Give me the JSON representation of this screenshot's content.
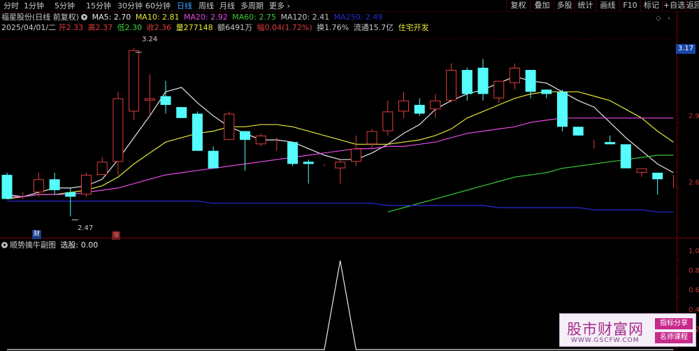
{
  "toolbar": {
    "periods": [
      "分时",
      "1分钟",
      "5分钟",
      "15分钟",
      "30分钟",
      "60分钟",
      "日线",
      "周线",
      "月线",
      "多周期",
      "更多"
    ],
    "active_period": "日线",
    "right_buttons": [
      "复权",
      "叠加",
      "多股",
      "统计",
      "画线",
      "F10",
      "标记",
      "+自选",
      "返回"
    ]
  },
  "stock": {
    "name": "福星股份(日线 前复权)",
    "date": "2025/04/01/二",
    "open_label": "开",
    "open": "2.33",
    "high_label": "高",
    "high": "2.37",
    "low_label": "低",
    "low": "2.30",
    "close_label": "收",
    "close": "2.36",
    "volume_label": "量",
    "volume": "277148",
    "amount_label": "额",
    "amount": "6491万",
    "change_label": "幅",
    "change": "0.04(1.72%)",
    "turnover": "换1.76%",
    "float_cap": "流通15.7亿",
    "sector": "住宅开发"
  },
  "ma": {
    "ma5": "MA5: 2.70",
    "ma10": "MA10: 2.81",
    "ma20": "MA20: 2.92",
    "ma60": "MA60: 2.75",
    "ma120": "MA120: 2.41",
    "ma250": "MA250: 2.49"
  },
  "colors": {
    "up": "#e03c3c",
    "down": "#54fcfc",
    "ma5": "#e8e8e8",
    "ma10": "#e6e63a",
    "ma20": "#e64ce6",
    "ma60": "#38c838",
    "ma250": "#2a2ad8",
    "accent": "#3c9dff"
  },
  "price_axis": {
    "current_price": "3.17",
    "ticks": [
      "2.9",
      "2.6"
    ],
    "high_marker": "3.24",
    "low_marker": "2.47"
  },
  "markers": {
    "finance": "财",
    "limit_up": "涨"
  },
  "sub_panel": {
    "title": "顺势擒牛副图",
    "value": "选股: 0.00",
    "ticks": [
      "1.0",
      "0.8",
      "0.6",
      "0.4",
      "0.2"
    ]
  },
  "watermark": {
    "title": "股市财富网",
    "url": "WWW.GSCFW.COM",
    "tag1": "指标分享",
    "tag2": "名师课程"
  },
  "chart_data": {
    "type": "candlestick",
    "x": [
      1,
      2,
      3,
      4,
      5,
      6,
      7,
      8,
      9,
      10,
      11,
      12,
      13,
      14,
      15,
      16,
      17,
      18,
      19,
      20,
      21,
      22,
      23,
      24,
      25,
      26,
      27,
      28,
      29,
      30,
      31,
      32,
      33,
      34,
      35,
      36,
      37,
      38,
      39,
      40,
      41,
      42,
      43
    ],
    "candles": [
      {
        "o": 2.66,
        "h": 2.67,
        "c": 2.55,
        "l": 2.55
      },
      {
        "o": 2.56,
        "h": 2.58,
        "c": 2.56,
        "l": 2.55
      },
      {
        "o": 2.58,
        "h": 2.67,
        "c": 2.64,
        "l": 2.56
      },
      {
        "o": 2.64,
        "h": 2.67,
        "c": 2.59,
        "l": 2.57
      },
      {
        "o": 2.58,
        "h": 2.6,
        "c": 2.56,
        "l": 2.47
      },
      {
        "o": 2.57,
        "h": 2.67,
        "c": 2.66,
        "l": 2.56
      },
      {
        "o": 2.66,
        "h": 2.74,
        "c": 2.72,
        "l": 2.66
      },
      {
        "o": 2.72,
        "h": 3.04,
        "c": 3.01,
        "l": 2.66
      },
      {
        "o": 2.95,
        "h": 3.24,
        "c": 3.23,
        "l": 2.91
      },
      {
        "o": 3.0,
        "h": 3.12,
        "c": 3.01,
        "l": 2.93
      },
      {
        "o": 3.02,
        "h": 3.09,
        "c": 2.98,
        "l": 2.94
      },
      {
        "o": 2.97,
        "h": 2.97,
        "c": 2.92,
        "l": 2.92
      },
      {
        "o": 2.94,
        "h": 2.95,
        "c": 2.77,
        "l": 2.77
      },
      {
        "o": 2.77,
        "h": 2.79,
        "c": 2.69,
        "l": 2.69
      },
      {
        "o": 2.82,
        "h": 2.95,
        "c": 2.94,
        "l": 2.82
      },
      {
        "o": 2.86,
        "h": 2.86,
        "c": 2.82,
        "l": 2.68
      },
      {
        "o": 2.8,
        "h": 2.85,
        "c": 2.84,
        "l": 2.79
      },
      {
        "o": 2.82,
        "h": 2.83,
        "c": 2.82,
        "l": 2.77
      },
      {
        "o": 2.81,
        "h": 2.81,
        "c": 2.71,
        "l": 2.7
      },
      {
        "o": 2.72,
        "h": 2.73,
        "c": 2.71,
        "l": 2.62
      },
      {
        "o": 2.7,
        "h": 2.71,
        "c": 2.7,
        "l": 2.7
      },
      {
        "o": 2.69,
        "h": 2.73,
        "c": 2.72,
        "l": 2.62
      },
      {
        "o": 2.72,
        "h": 2.84,
        "c": 2.78,
        "l": 2.7
      },
      {
        "o": 2.8,
        "h": 2.87,
        "c": 2.86,
        "l": 2.78
      },
      {
        "o": 2.86,
        "h": 3.0,
        "c": 2.95,
        "l": 2.84
      },
      {
        "o": 2.95,
        "h": 3.04,
        "c": 3.0,
        "l": 2.92
      },
      {
        "o": 2.98,
        "h": 3.01,
        "c": 2.94,
        "l": 2.93
      },
      {
        "o": 2.96,
        "h": 3.03,
        "c": 3.0,
        "l": 2.92
      },
      {
        "o": 3.0,
        "h": 3.17,
        "c": 3.14,
        "l": 2.99
      },
      {
        "o": 3.14,
        "h": 3.15,
        "c": 3.03,
        "l": 3.0
      },
      {
        "o": 3.15,
        "h": 3.19,
        "c": 3.03,
        "l": 3.0
      },
      {
        "o": 3.01,
        "h": 3.09,
        "c": 3.09,
        "l": 2.99
      },
      {
        "o": 3.08,
        "h": 3.17,
        "c": 3.15,
        "l": 3.05
      },
      {
        "o": 3.14,
        "h": 3.14,
        "c": 3.04,
        "l": 3.01
      },
      {
        "o": 3.05,
        "h": 3.05,
        "c": 3.03,
        "l": 3.01
      },
      {
        "o": 3.04,
        "h": 3.05,
        "c": 2.88,
        "l": 2.86
      },
      {
        "o": 2.88,
        "h": 2.88,
        "c": 2.84,
        "l": 2.84
      },
      {
        "o": 2.82,
        "h": 2.82,
        "c": 2.82,
        "l": 2.78
      },
      {
        "o": 2.81,
        "h": 2.84,
        "c": 2.8,
        "l": 2.8
      },
      {
        "o": 2.8,
        "h": 2.8,
        "c": 2.69,
        "l": 2.69
      },
      {
        "o": 2.67,
        "h": 2.69,
        "c": 2.69,
        "l": 2.65
      },
      {
        "o": 2.67,
        "h": 2.67,
        "c": 2.64,
        "l": 2.57
      },
      {
        "o": 2.62,
        "h": 2.66,
        "c": 2.62,
        "l": 2.6
      }
    ],
    "series": [
      {
        "name": "MA5",
        "values": [
          2.57,
          2.56,
          2.58,
          2.6,
          2.6,
          2.61,
          2.64,
          2.73,
          2.83,
          2.93,
          3.04,
          3.06,
          2.99,
          2.93,
          2.88,
          2.85,
          2.82,
          2.82,
          2.81,
          2.78,
          2.75,
          2.73,
          2.73,
          2.76,
          2.8,
          2.85,
          2.89,
          2.96,
          3.0,
          3.03,
          3.05,
          3.08,
          3.11,
          3.09,
          3.08,
          3.04,
          3.0,
          2.97,
          2.9,
          2.83,
          2.77,
          2.71,
          2.67
        ]
      },
      {
        "name": "MA10",
        "values": [
          2.55,
          2.56,
          2.57,
          2.57,
          2.58,
          2.59,
          2.61,
          2.65,
          2.71,
          2.76,
          2.81,
          2.83,
          2.85,
          2.86,
          2.88,
          2.88,
          2.89,
          2.89,
          2.88,
          2.86,
          2.84,
          2.82,
          2.8,
          2.8,
          2.8,
          2.81,
          2.82,
          2.84,
          2.87,
          2.92,
          2.95,
          2.98,
          3.01,
          3.03,
          3.04,
          3.04,
          3.04,
          3.02,
          3.0,
          2.96,
          2.92,
          2.86,
          2.81
        ]
      },
      {
        "name": "MA20",
        "values": [
          2.56,
          2.56,
          2.57,
          2.57,
          2.57,
          2.58,
          2.59,
          2.6,
          2.62,
          2.64,
          2.66,
          2.67,
          2.68,
          2.69,
          2.7,
          2.71,
          2.72,
          2.73,
          2.74,
          2.75,
          2.76,
          2.77,
          2.78,
          2.78,
          2.79,
          2.79,
          2.8,
          2.81,
          2.83,
          2.85,
          2.86,
          2.87,
          2.88,
          2.9,
          2.91,
          2.92,
          2.92,
          2.92,
          2.92,
          2.92,
          2.92,
          2.92,
          2.92
        ]
      },
      {
        "name": "MA60",
        "values": [
          null,
          null,
          null,
          null,
          null,
          null,
          null,
          null,
          null,
          null,
          null,
          null,
          null,
          null,
          null,
          null,
          null,
          null,
          null,
          null,
          null,
          null,
          null,
          null,
          2.49,
          2.51,
          2.53,
          2.55,
          2.57,
          2.59,
          2.61,
          2.63,
          2.65,
          2.66,
          2.67,
          2.69,
          2.7,
          2.71,
          2.72,
          2.73,
          2.74,
          2.75,
          2.75
        ]
      },
      {
        "name": "MA250",
        "values": [
          2.54,
          2.54,
          2.54,
          2.54,
          2.54,
          2.54,
          2.54,
          2.54,
          2.54,
          2.54,
          2.54,
          2.54,
          2.54,
          2.53,
          2.53,
          2.53,
          2.53,
          2.53,
          2.53,
          2.53,
          2.53,
          2.53,
          2.53,
          2.53,
          2.52,
          2.52,
          2.52,
          2.52,
          2.52,
          2.52,
          2.52,
          2.51,
          2.51,
          2.51,
          2.51,
          2.51,
          2.51,
          2.5,
          2.5,
          2.5,
          2.5,
          2.49,
          2.49
        ]
      }
    ],
    "sub_series": {
      "name": "选股",
      "values": [
        0,
        0,
        0,
        0,
        0,
        0,
        0,
        0,
        0,
        0,
        0,
        0,
        0,
        0,
        0,
        0,
        0,
        0,
        0,
        0,
        0,
        1,
        0,
        0,
        0,
        0,
        0,
        0,
        0,
        0,
        0,
        0,
        0,
        0,
        0,
        0,
        0,
        0,
        0,
        0,
        0,
        0,
        0
      ]
    },
    "ylim": [
      2.43,
      3.3
    ],
    "sub_ylim": [
      0,
      1.1
    ]
  }
}
